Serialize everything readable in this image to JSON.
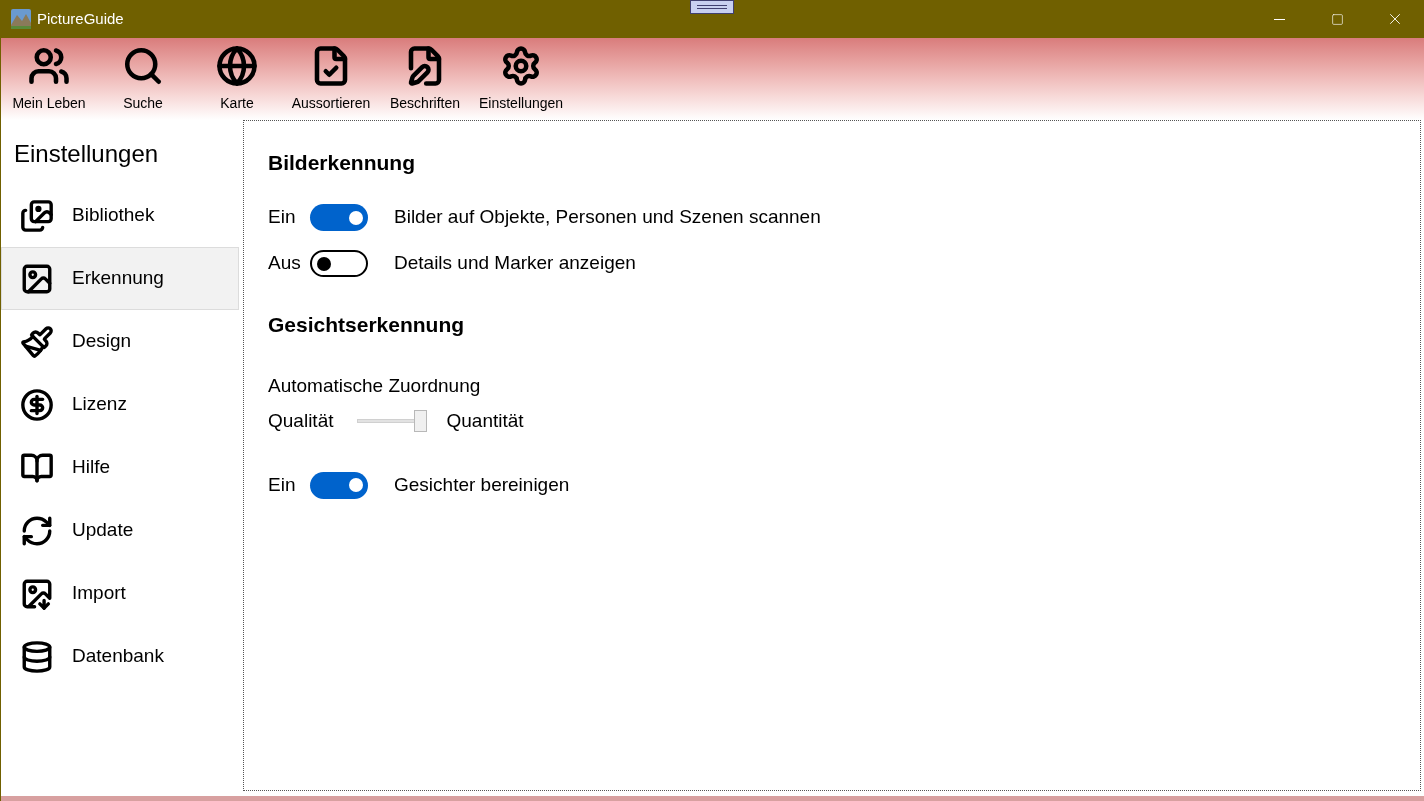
{
  "window": {
    "title": "PictureGuide"
  },
  "toolbar": [
    {
      "label": "Mein Leben"
    },
    {
      "label": "Suche"
    },
    {
      "label": "Karte"
    },
    {
      "label": "Aussortieren"
    },
    {
      "label": "Beschriften"
    },
    {
      "label": "Einstellungen"
    }
  ],
  "sidebar": {
    "title": "Einstellungen",
    "items": [
      {
        "label": "Bibliothek",
        "selected": false
      },
      {
        "label": "Erkennung",
        "selected": true
      },
      {
        "label": "Design",
        "selected": false
      },
      {
        "label": "Lizenz",
        "selected": false
      },
      {
        "label": "Hilfe",
        "selected": false
      },
      {
        "label": "Update",
        "selected": false
      },
      {
        "label": "Import",
        "selected": false
      },
      {
        "label": "Datenbank",
        "selected": false
      }
    ]
  },
  "sections": [
    {
      "title": "Bilderkennung",
      "rows": [
        {
          "kind": "toggle",
          "state_label": "Ein",
          "on": true,
          "label": "Bilder auf Objekte, Personen und Szenen scannen"
        },
        {
          "kind": "toggle",
          "state_label": "Aus",
          "on": false,
          "label": "Details und Marker anzeigen"
        }
      ]
    },
    {
      "title": "Gesichtserkennung",
      "rows": [
        {
          "kind": "text",
          "label": "Automatische Zuordnung"
        },
        {
          "kind": "slider",
          "left_label": "Qualität",
          "right_label": "Quantität",
          "level": 1
        },
        {
          "kind": "toggle",
          "state_label": "Ein",
          "on": true,
          "label": "Gesichter bereinigen"
        }
      ]
    }
  ]
}
